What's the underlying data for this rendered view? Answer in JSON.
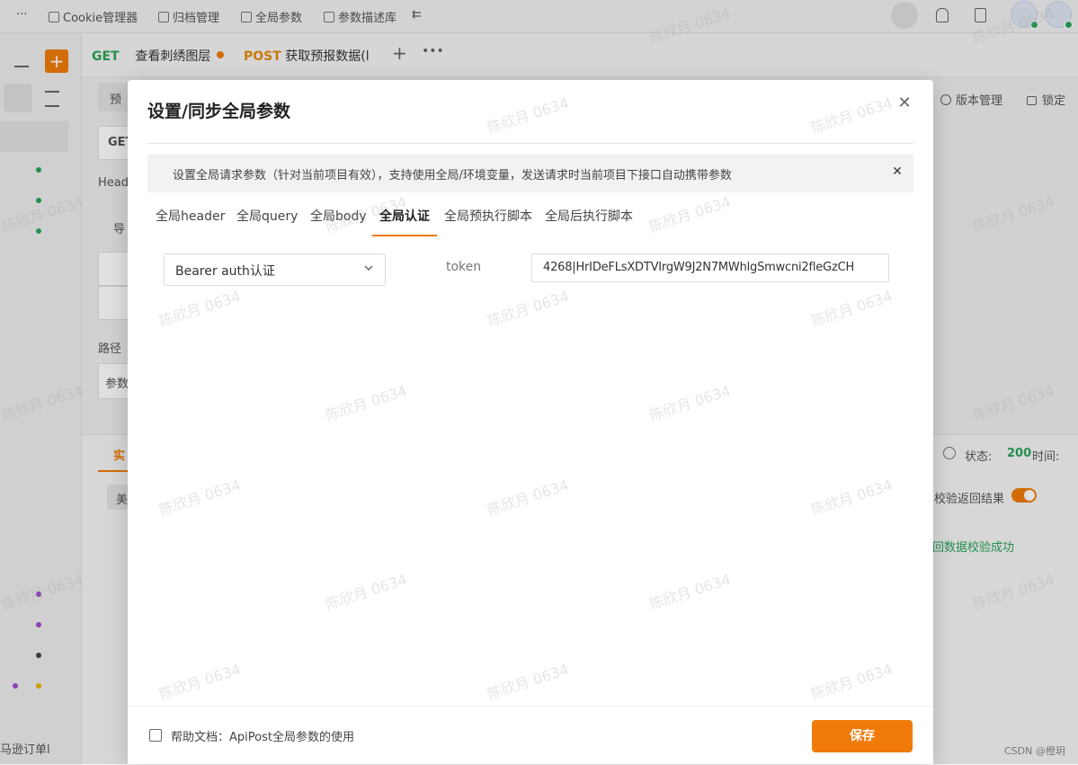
{
  "topbar": {
    "items": [
      "···",
      "Cookie管理器",
      "归档管理",
      "全局参数",
      "参数描述库"
    ],
    "collapse_glyph": "⇇"
  },
  "tabs": [
    {
      "method": "GET",
      "name": "查看刺绣图层"
    },
    {
      "method": "POST",
      "name": "获取预报数据(l"
    }
  ],
  "header_actions": {
    "version": "版本管理",
    "lock": "锁定"
  },
  "background": {
    "pre_label": "预",
    "get_label": "GET",
    "header_label": "Head",
    "import_label": "导",
    "path_label": "路径",
    "param_label": "参数",
    "real_label": "实",
    "beauty_label": "美",
    "status_label": "状态:",
    "status_value": "200",
    "time_label": "时间:",
    "verify_label": "校验返回结果",
    "verify_result": "回数据校验成功",
    "left_bottom": "马逊订单l",
    "csdn": "CSDN @橙玥"
  },
  "modal": {
    "title": "设置/同步全局参数",
    "notice": "设置全局请求参数（针对当前项目有效），支持使用全局/环境变量，发送请求时当前项目下接口自动携带参数",
    "tabs": [
      "全局header",
      "全局query",
      "全局body",
      "全局认证",
      "全局预执行脚本",
      "全局后执行脚本"
    ],
    "active_tab": "全局认证",
    "auth_type": "Bearer auth认证",
    "token_label": "token",
    "token_value": "4268|HrIDeFLsXDTVIrgW9J2N7MWhlgSmwcni2fleGzCH",
    "help_text": "帮助文档：ApiPost全局参数的使用",
    "save_label": "保存"
  },
  "watermark": "陈欣月 0634",
  "colors": {
    "accent": "#f07b0a",
    "get": "#2aa35a",
    "post": "#e8890c"
  }
}
